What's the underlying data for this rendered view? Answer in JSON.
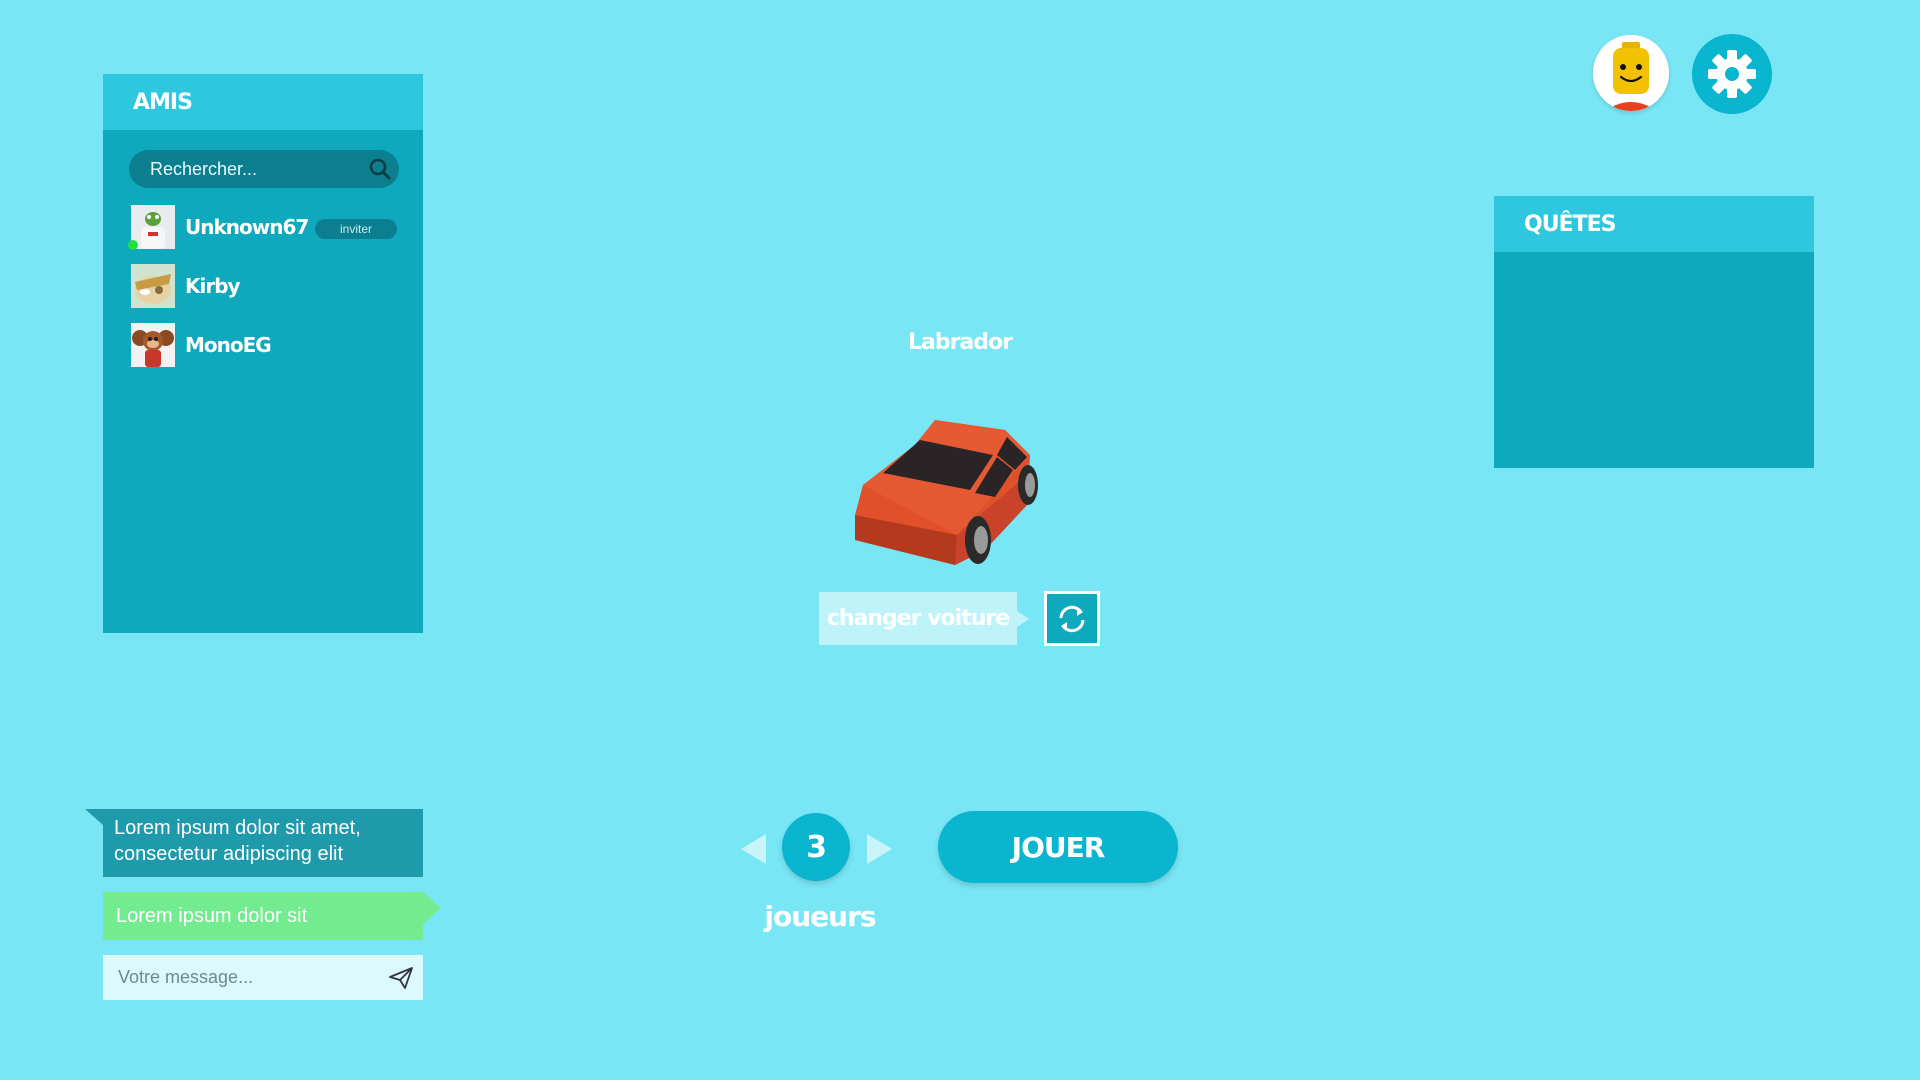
{
  "friends": {
    "title": "AMIS",
    "search_placeholder": "Rechercher...",
    "list": [
      {
        "name": "Unknown67",
        "online": true,
        "invite_label": "inviter"
      },
      {
        "name": "Kirby",
        "online": false
      },
      {
        "name": "MonoEG",
        "online": false
      }
    ]
  },
  "chat": {
    "incoming_message": "Lorem ipsum dolor sit amet, consectetur adipiscing elit",
    "outgoing_message": "Lorem ipsum dolor sit",
    "input_placeholder": "Votre message..."
  },
  "car": {
    "name": "Labrador",
    "change_label": "changer voiture",
    "color": "#e0502a"
  },
  "players": {
    "count": "3",
    "label": "joueurs"
  },
  "play": {
    "label": "JOUER"
  },
  "quests": {
    "title": "QUÊTES"
  },
  "colors": {
    "background": "#79e6f5",
    "panel": "#0ea9bd",
    "panel_header": "#2ec7de",
    "accent": "#0ab5cf",
    "online": "#23e13b"
  }
}
